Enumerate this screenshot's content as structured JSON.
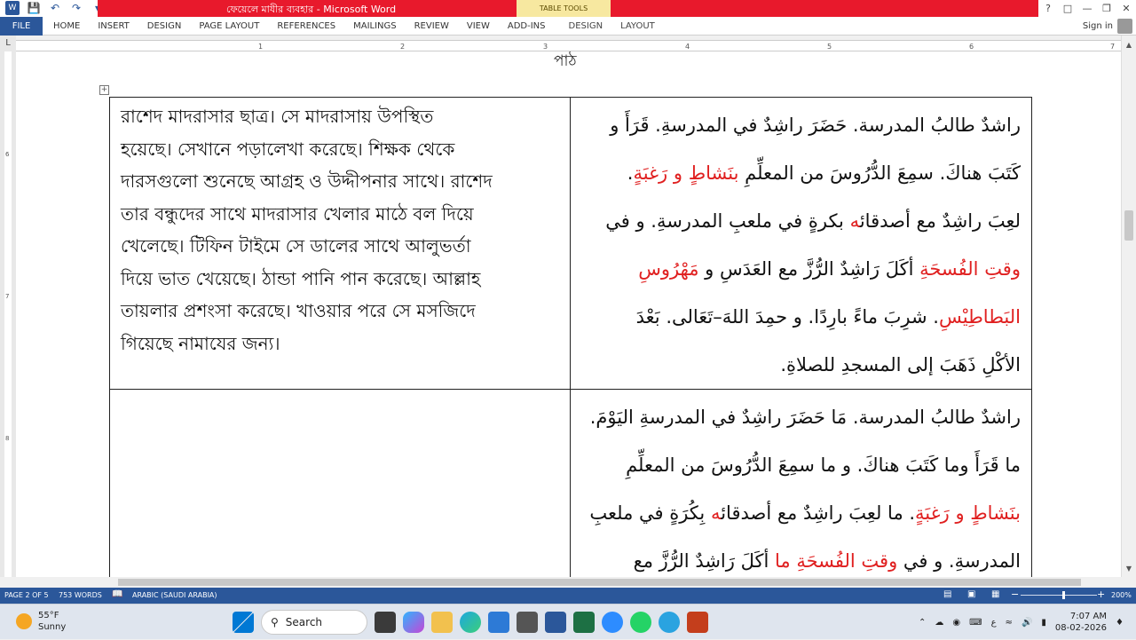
{
  "window": {
    "title": "ফেয়েলে মাযীর ব্যবহার - Microsoft Word",
    "table_tools_label": "TABLE TOOLS"
  },
  "qat": {
    "icons": [
      "word-logo-icon",
      "save-icon",
      "undo-icon",
      "redo-icon",
      "customize-icon"
    ]
  },
  "ribbon": {
    "file_label": "FILE",
    "tabs": [
      "HOME",
      "INSERT",
      "DESIGN",
      "PAGE LAYOUT",
      "REFERENCES",
      "MAILINGS",
      "REVIEW",
      "VIEW",
      "ADD-INS"
    ],
    "table_tabs": [
      "DESIGN",
      "LAYOUT"
    ],
    "sign_in": "Sign in"
  },
  "ruler": {
    "corner": "L",
    "ticks": [
      "1",
      "2",
      "3",
      "4",
      "5",
      "6",
      "7"
    ],
    "vticks": [
      "6",
      "7",
      "8"
    ]
  },
  "document": {
    "page_header": "পাঠ",
    "move_handle": "+",
    "bengali_paragraph": [
      "রাশেদ মাদরাসার ছাত্র। সে মাদরাসায় উপস্থিত",
      "হয়েছে। সেখানে পড়ালেখা করেছে। শিক্ষক থেকে",
      "দারসগুলো শুনেছে আগ্রহ ও উদ্দীপনার সাথে। রাশেদ",
      "তার বন্ধুদের সাথে মাদরাসার খেলার মাঠে বল দিয়ে",
      "খেলেছে। টিফিন টাইমে সে ডালের সাথে আলুভর্তা",
      "দিয়ে ভাত খেয়েছে। ঠান্ডা পানি পান করেছে। আল্লাহ",
      "তায়লার প্রশংসা করেছে। খাওয়ার পরে সে মসজিদে",
      "গিয়েছে নামাযের জন্য।"
    ],
    "arabic_row1": [
      {
        "parts": [
          {
            "t": "راشدٌ طالبُ المدرسة. حَضَرَ راشِدٌ في المدرسةِ. قَرَأَ و",
            "red": false
          }
        ]
      },
      {
        "parts": [
          {
            "t": "كَتَبَ هناكَ. سمِعَ الدُّرُوسَ من المعلِّمِ ",
            "red": false
          },
          {
            "t": "بنَشاطٍ و رَغبَةٍ",
            "red": true
          },
          {
            "t": ".",
            "red": false
          }
        ]
      },
      {
        "parts": [
          {
            "t": "لعِبَ راشِدٌ مع أصدقائ",
            "red": false
          },
          {
            "t": "ه",
            "red": true
          },
          {
            "t": " بكرةٍ في ملعبِ المدرسةِ. و في",
            "red": false
          }
        ]
      },
      {
        "parts": [
          {
            "t": "وقتِ الفُسحَةِ",
            "red": true
          },
          {
            "t": " أكَلَ رَاشِدٌ الرُّزَّ مع العَدَسِ و ",
            "red": false
          },
          {
            "t": "مَهْرُوسِ",
            "red": true
          }
        ]
      },
      {
        "parts": [
          {
            "t": "البَطاطِيْسِ",
            "red": true
          },
          {
            "t": ". شرِبَ ماءً بارِدًا. و حمِدَ اللهَ–تَعَالى. بَعْدَ",
            "red": false
          }
        ]
      },
      {
        "parts": [
          {
            "t": "الأكْلِ ذَهَبَ إلى المسجدِ للصلاةِ.",
            "red": false
          }
        ]
      }
    ],
    "arabic_row2": [
      {
        "parts": [
          {
            "t": "راشدٌ طالبُ المدرسة. مَا حَضَرَ راشِدٌ في المدرسةِ اليَوْمَ.",
            "red": false
          }
        ]
      },
      {
        "parts": [
          {
            "t": "ما قَرَأَ وما كَتَبَ هناكَ. و ما سمِعَ الدُّرُوسَ من المعلِّمِ",
            "red": false
          }
        ]
      },
      {
        "parts": [
          {
            "t": "بنَشاطٍ و رَغبَةٍ",
            "red": true
          },
          {
            "t": ". ما لعِبَ راشِدٌ مع أصدقائ",
            "red": false
          },
          {
            "t": "ه",
            "red": true
          },
          {
            "t": " بِكُرَةٍ في ملعبِ",
            "red": false
          }
        ]
      },
      {
        "parts": [
          {
            "t": "المدرسةِ. و في ",
            "red": false
          },
          {
            "t": "وقتِ الفُسحَةِ",
            "red": true
          },
          {
            "t": " ما",
            "red": true
          },
          {
            "t": " أكَلَ رَاشِدٌ الرُّزَّ مع",
            "red": false
          }
        ]
      }
    ]
  },
  "statusbar": {
    "page": "PAGE 2 OF 5",
    "words": "753 WORDS",
    "language": "ARABIC (SAUDI ARABIA)",
    "zoom_minus": "−",
    "zoom_plus": "+",
    "zoom": "200%"
  },
  "taskbar": {
    "temperature": "55°F",
    "condition": "Sunny",
    "search_label": "Search",
    "language_indicator": "ع",
    "time": "7:07 AM",
    "date": "08-02-2026"
  },
  "colors": {
    "word_blue": "#2b579a",
    "title_red": "#e8192c",
    "arabic_highlight": "#e02020"
  }
}
